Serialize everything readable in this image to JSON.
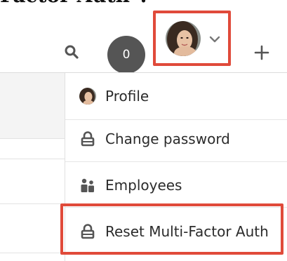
{
  "page": {
    "heading_fragment": "Factor Auth\"."
  },
  "toolbar": {
    "notification_count": "0",
    "icons": {
      "search": "search-icon",
      "caret": "chevron-down-icon",
      "add": "plus-icon"
    }
  },
  "user_menu": {
    "items": [
      {
        "label": "Profile",
        "icon": "avatar-icon"
      },
      {
        "label": "Change password",
        "icon": "lock-icon"
      },
      {
        "label": "Employees",
        "icon": "people-icon"
      },
      {
        "label": "Reset Multi-Factor Auth",
        "icon": "lock-icon"
      }
    ]
  },
  "colors": {
    "highlight": "#e04a3a",
    "badge": "#555555",
    "text": "#2b2b2b"
  }
}
